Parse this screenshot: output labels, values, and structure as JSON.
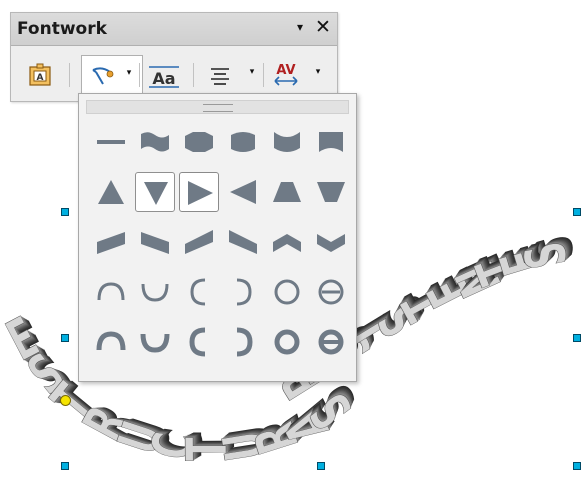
{
  "toolbar": {
    "title": "Fontwork",
    "menu_glyph": "▾",
    "close_glyph": "✕",
    "buttons": [
      {
        "name": "fontwork-gallery-icon"
      },
      {
        "name": "fontwork-shape-icon",
        "active": true
      },
      {
        "name": "fontwork-same-letter-heights-icon"
      },
      {
        "name": "fontwork-alignment-icon"
      },
      {
        "name": "fontwork-character-spacing-icon"
      }
    ],
    "dropdown_glyph": "▾"
  },
  "shape_popup": {
    "rows": [
      [
        "plain-text",
        "wave",
        "inflate",
        "curve-up-inflate",
        "chevron-up-curve",
        "curve-down"
      ],
      [
        "triangle-up",
        "triangle-down",
        "fade-right",
        "fade-left",
        "fade-up",
        "fade-down"
      ],
      [
        "slant-up",
        "slant-down",
        "fade-up-right",
        "fade-up-left",
        "chevron-up",
        "chevron-down"
      ],
      [
        "arch-up-curve",
        "arch-down-curve",
        "arch-left-curve",
        "arch-right-curve",
        "circle-curve",
        "open-circle-curve"
      ],
      [
        "arch-up-pour",
        "arch-down-pour",
        "arch-left-pour",
        "arch-right-pour",
        "circle-pour",
        "open-circle-pour"
      ]
    ],
    "highlighted": [
      "triangle-down",
      "fade-right"
    ]
  },
  "fontwork_text": {
    "word1": "ESTRUCTURAS",
    "word2": "RESISTENTES"
  },
  "colors": {
    "handle": "#00b0e0",
    "handle_point": "#f5e400",
    "shape_fill": "#6f7a86"
  }
}
